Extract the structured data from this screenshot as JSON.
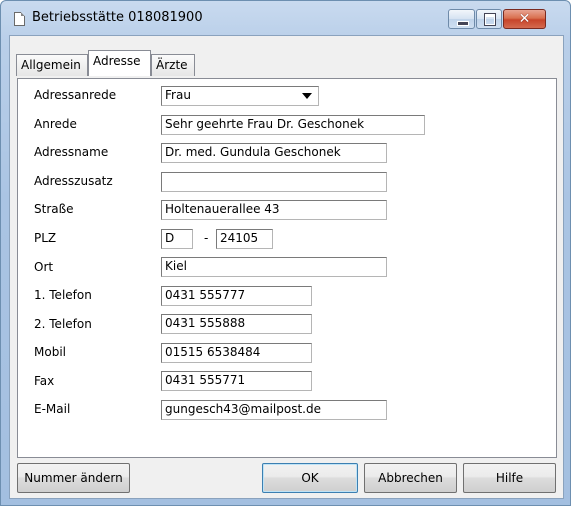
{
  "window": {
    "title": "Betriebsstätte 018081900",
    "close_glyph": "✕"
  },
  "tabs": [
    {
      "label": "Allgemein"
    },
    {
      "label": "Adresse"
    },
    {
      "label": "Ärzte"
    }
  ],
  "form": {
    "adressanrede": {
      "label": "Adressanrede",
      "value": "Frau"
    },
    "anrede": {
      "label": "Anrede",
      "value": "Sehr geehrte Frau Dr. Geschonek"
    },
    "adressname": {
      "label": "Adressname",
      "value": "Dr. med. Gundula Geschonek"
    },
    "adresszusatz": {
      "label": "Adresszusatz",
      "value": ""
    },
    "strasse": {
      "label": "Straße",
      "value": "Holtenauerallee 43"
    },
    "plz": {
      "label": "PLZ",
      "country": "D",
      "separator": "-",
      "value": "24105"
    },
    "ort": {
      "label": "Ort",
      "value": "Kiel"
    },
    "telefon1": {
      "label": "1. Telefon",
      "value": "0431 555777"
    },
    "telefon2": {
      "label": "2. Telefon",
      "value": "0431 555888"
    },
    "mobil": {
      "label": "Mobil",
      "value": "01515 6538484"
    },
    "fax": {
      "label": "Fax",
      "value": "0431 555771"
    },
    "email": {
      "label": "E-Mail",
      "value": "gungesch43@mailpost.de"
    }
  },
  "buttons": {
    "nummer_aendern": "Nummer ändern",
    "ok": "OK",
    "abbrechen": "Abbrechen",
    "hilfe": "Hilfe"
  }
}
